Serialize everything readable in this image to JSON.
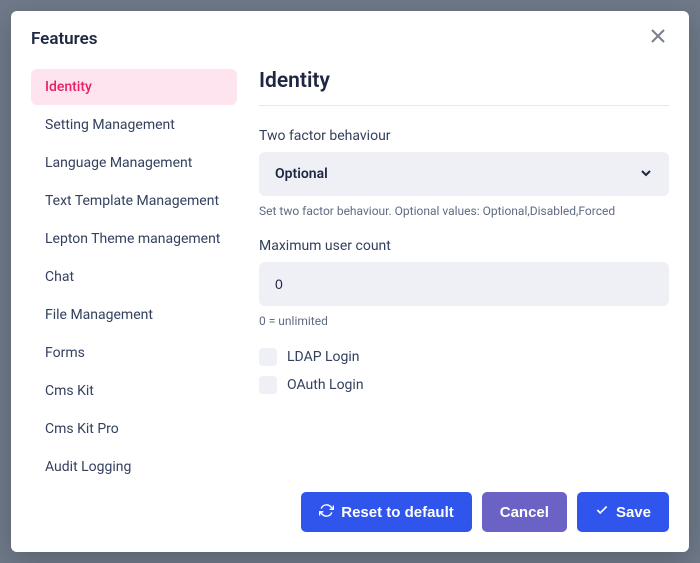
{
  "modal": {
    "title": "Features"
  },
  "sidebar": {
    "items": [
      {
        "label": "Identity",
        "active": true
      },
      {
        "label": "Setting Management",
        "active": false
      },
      {
        "label": "Language Management",
        "active": false
      },
      {
        "label": "Text Template Management",
        "active": false
      },
      {
        "label": "Lepton Theme management",
        "active": false
      },
      {
        "label": "Chat",
        "active": false
      },
      {
        "label": "File Management",
        "active": false
      },
      {
        "label": "Forms",
        "active": false
      },
      {
        "label": "Cms Kit",
        "active": false
      },
      {
        "label": "Cms Kit Pro",
        "active": false
      },
      {
        "label": "Audit Logging",
        "active": false
      }
    ]
  },
  "content": {
    "title": "Identity",
    "two_factor": {
      "label": "Two factor behaviour",
      "value": "Optional",
      "help": "Set two factor behaviour. Optional values: Optional,Disabled,Forced"
    },
    "max_user": {
      "label": "Maximum user count",
      "value": "0",
      "help": "0 = unlimited"
    },
    "ldap": {
      "label": "LDAP Login",
      "checked": false
    },
    "oauth": {
      "label": "OAuth Login",
      "checked": false
    }
  },
  "footer": {
    "reset": "Reset to default",
    "cancel": "Cancel",
    "save": "Save"
  }
}
